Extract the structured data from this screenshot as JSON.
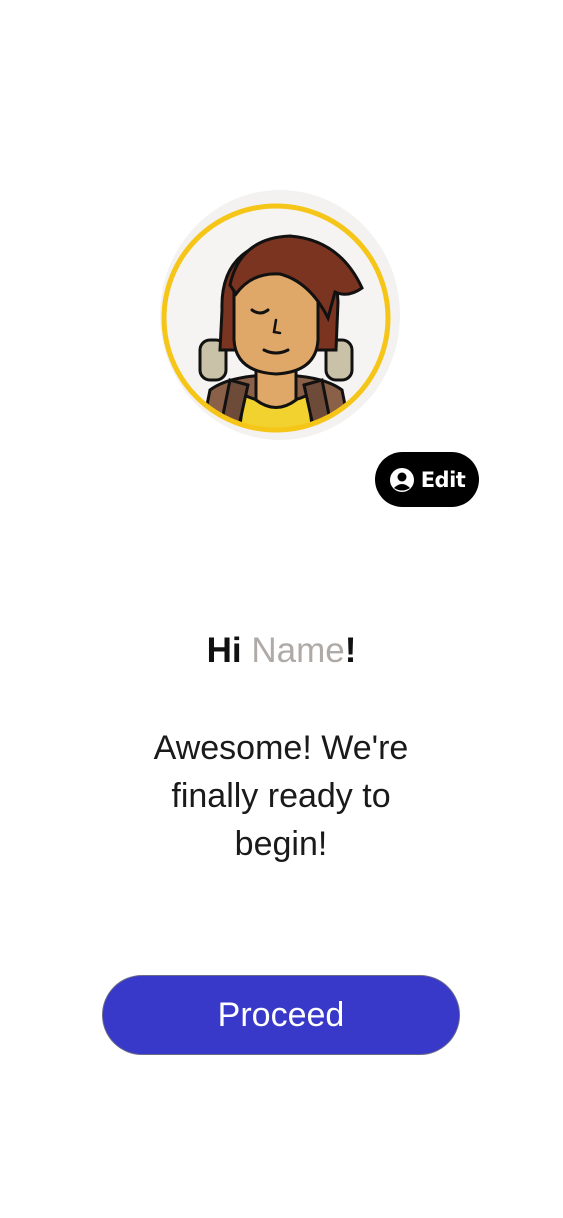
{
  "profile": {
    "avatar_icon": "hiker-avatar-icon",
    "edit_icon": "user-circle-icon",
    "edit_label": "Edit"
  },
  "greeting": {
    "hi": "Hi",
    "name_placeholder": "Name",
    "exclamation": "!"
  },
  "message": "Awesome! We're finally ready to begin!",
  "actions": {
    "proceed_label": "Proceed"
  },
  "colors": {
    "primary_button": "#3838c9",
    "avatar_ring": "#f5c518",
    "name_placeholder": "#b0aaa6"
  }
}
